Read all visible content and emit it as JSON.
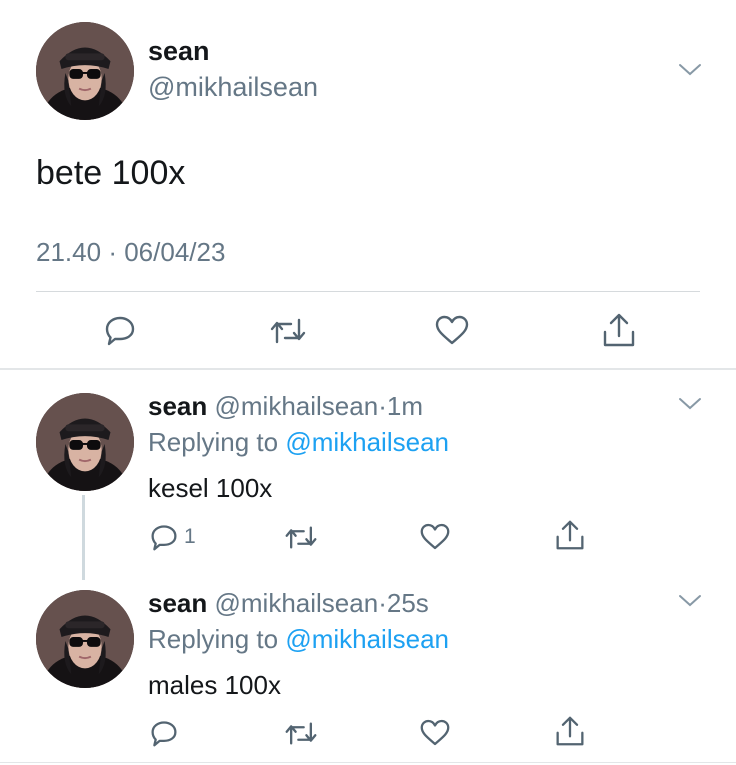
{
  "main_tweet": {
    "name": "sean",
    "handle": "@mikhailsean",
    "text": "bete 100x",
    "time": "21.40",
    "date": "06/04/23",
    "separator": "·"
  },
  "replies": [
    {
      "name": "sean",
      "handle": "@mikhailsean",
      "separator": "·",
      "time_ago": "1m",
      "replying_prefix": "Replying to",
      "replying_to": "@mikhailsean",
      "text": "kesel 100x",
      "reply_count": "1"
    },
    {
      "name": "sean",
      "handle": "@mikhailsean",
      "separator": "·",
      "time_ago": "25s",
      "replying_prefix": "Replying to",
      "replying_to": "@mikhailsean",
      "text": "males 100x",
      "reply_count": ""
    }
  ],
  "icons": [
    "avatar",
    "chevron-down-icon",
    "reply-icon",
    "retweet-icon",
    "like-icon",
    "share-icon"
  ],
  "colors": {
    "text": "#14171a",
    "muted": "#657786",
    "link": "#1da1f2",
    "divider": "#d6dadd"
  }
}
